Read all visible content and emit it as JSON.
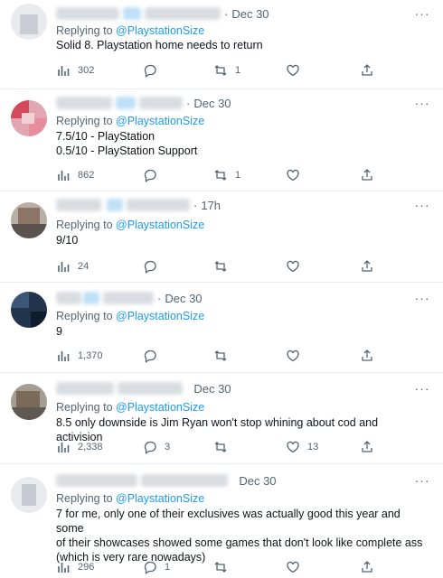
{
  "reply_prefix": "Replying to",
  "reply_handle": "@PlaystationSize",
  "more_label": "···",
  "tweets": [
    {
      "name_fragment": "Du",
      "handle_fragment": "@deathm",
      "date": "Dec 30",
      "lines": [
        "Solid 8. Playstation home needs to return"
      ],
      "views": "302",
      "replies": "",
      "retweets": "1",
      "likes": ""
    },
    {
      "name_fragment": "",
      "handle_fragment": "",
      "date": "Dec 30",
      "lines": [
        "7.5/10 - PlayStation",
        "0.5/10 - PlayStation Support"
      ],
      "views": "862",
      "replies": "",
      "retweets": "1",
      "likes": ""
    },
    {
      "name_fragment": "",
      "handle_fragment": "",
      "date": "17h",
      "lines": [
        "9/10"
      ],
      "views": "24",
      "replies": "",
      "retweets": "",
      "likes": ""
    },
    {
      "name_fragment": "",
      "handle_fragment": "",
      "date": "Dec 30",
      "lines": [
        "9"
      ],
      "views": "1,370",
      "replies": "",
      "retweets": "",
      "likes": ""
    },
    {
      "name_fragment": "",
      "handle_fragment": "",
      "date": "Dec 30",
      "lines": [
        "8.5 only downside is Jim Ryan won't stop whining about cod and activision"
      ],
      "views": "2,338",
      "replies": "3",
      "retweets": "",
      "likes": "13"
    },
    {
      "name_fragment": "",
      "handle_fragment": "",
      "date": "Dec 30",
      "lines": [
        "7 for me, only one of their exclusives was actually good this year and some",
        "of their showcases showed some games that don't look like complete ass",
        "(which is very rare nowadays)"
      ],
      "views": "296",
      "replies": "1",
      "retweets": "",
      "likes": ""
    }
  ]
}
